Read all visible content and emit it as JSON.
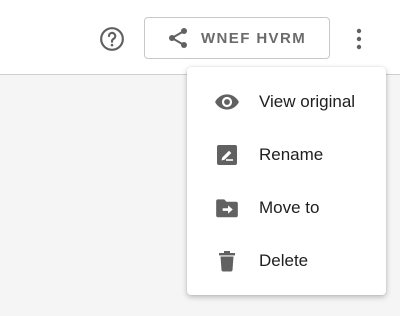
{
  "toolbar": {
    "help_icon": "help-circle-icon",
    "share_button": {
      "icon": "share-icon",
      "label": "WNEF HVRM"
    },
    "more_icon": "more-vertical-icon"
  },
  "menu": {
    "items": [
      {
        "icon": "eye-icon",
        "label": "View original"
      },
      {
        "icon": "rename-icon",
        "label": "Rename"
      },
      {
        "icon": "move-folder-icon",
        "label": "Move to"
      },
      {
        "icon": "trash-icon",
        "label": "Delete"
      }
    ]
  },
  "colors": {
    "icon": "#616161",
    "text": "#202020",
    "button_text": "#6b6b6b"
  }
}
